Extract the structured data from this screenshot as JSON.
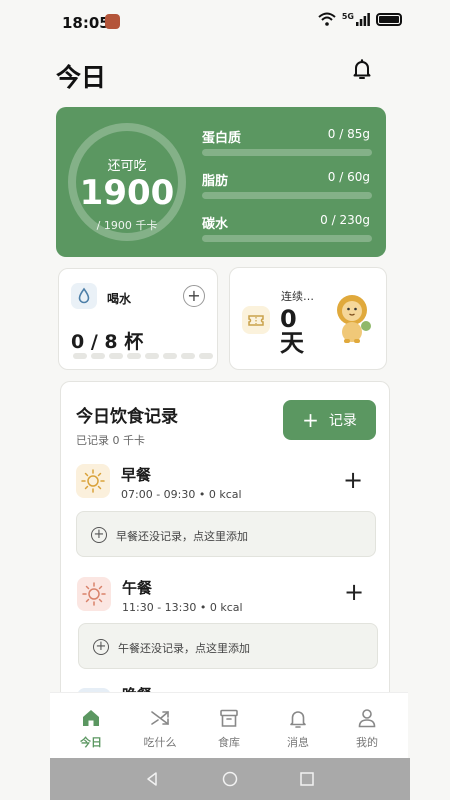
{
  "status_bar": {
    "time": "18:05",
    "network": "5G"
  },
  "header": {
    "title": "今日"
  },
  "calories": {
    "label": "还可吃",
    "remaining": "1900",
    "target": "/ 1900 千卡"
  },
  "macros": [
    {
      "name": "蛋白质",
      "value": "0 / 85g"
    },
    {
      "name": "脂肪",
      "value": "0 / 60g"
    },
    {
      "name": "碳水",
      "value": "0 / 230g"
    }
  ],
  "water": {
    "label": "喝水",
    "count": "0 / 8 杯",
    "cups_total": 8,
    "cups_filled": 0
  },
  "streak": {
    "label": "连续…",
    "days": "0",
    "unit": "天"
  },
  "diary": {
    "title": "今日饮食记录",
    "subtitle": "已记录 0 千卡",
    "record_button": "记录",
    "meals": [
      {
        "name": "早餐",
        "meta": "07:00 - 09:30 • 0 kcal",
        "empty": "早餐还没记录，点这里添加",
        "icon": "sun-icon"
      },
      {
        "name": "午餐",
        "meta": "11:30 - 13:30 • 0 kcal",
        "empty": "午餐还没记录，点这里添加",
        "icon": "sun-icon"
      },
      {
        "name": "晚餐",
        "meta": "",
        "empty": "",
        "icon": "moon-icon"
      }
    ]
  },
  "tabs": [
    {
      "label": "今日",
      "icon": "home-icon",
      "active": true
    },
    {
      "label": "吃什么",
      "icon": "shuffle-icon",
      "active": false
    },
    {
      "label": "食库",
      "icon": "archive-icon",
      "active": false
    },
    {
      "label": "消息",
      "icon": "bell-icon",
      "active": false
    },
    {
      "label": "我的",
      "icon": "user-icon",
      "active": false
    }
  ],
  "colors": {
    "accent": "#5b9761",
    "background": "#f7f7f5",
    "card": "#ffffff"
  }
}
